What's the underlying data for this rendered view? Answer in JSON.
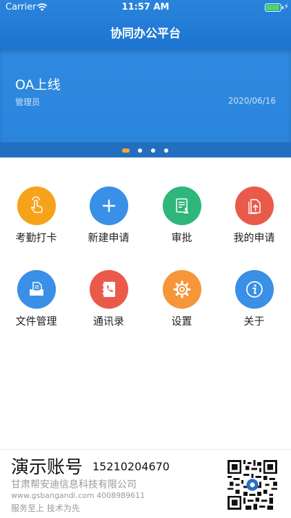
{
  "status": {
    "carrier": "Carrier",
    "time": "11:57 AM"
  },
  "nav": {
    "title": "协同办公平台"
  },
  "banner": {
    "title": "OA上线",
    "author": "管理员",
    "date": "2020/06/16",
    "slide_count": 4,
    "active_slide": 1
  },
  "grid": {
    "items": [
      {
        "label": "考勤打卡",
        "icon": "hand-tap-icon",
        "color": "#f7a21b"
      },
      {
        "label": "新建申请",
        "icon": "plus-icon",
        "color": "#3a8fe6"
      },
      {
        "label": "审批",
        "icon": "document-approve-icon",
        "color": "#2fb67a"
      },
      {
        "label": "我的申请",
        "icon": "document-upload-icon",
        "color": "#ea5a4a"
      },
      {
        "label": "文件管理",
        "icon": "file-tray-icon",
        "color": "#3a8fe6"
      },
      {
        "label": "通讯录",
        "icon": "phone-book-icon",
        "color": "#ea5a4a"
      },
      {
        "label": "设置",
        "icon": "gear-icon",
        "color": "#f7953a"
      },
      {
        "label": "关于",
        "icon": "info-icon",
        "color": "#3a8fe6"
      }
    ]
  },
  "footer": {
    "account_title": "演示账号",
    "account_phone": "15210204670",
    "company": "甘肃帮安迪信息科技有限公司",
    "website_phone": "www.gsbangandi.com 4008989611",
    "slogan": "服务至上  技术为先"
  },
  "colors": {
    "primary": "#2a84dc",
    "dot_active": "#f7a92b"
  }
}
